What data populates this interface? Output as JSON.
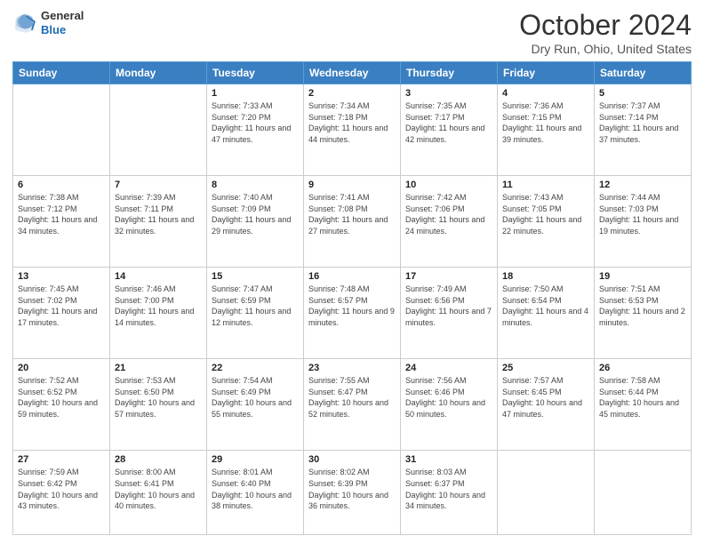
{
  "header": {
    "logo": {
      "general": "General",
      "blue": "Blue"
    },
    "title": "October 2024",
    "subtitle": "Dry Run, Ohio, United States"
  },
  "calendar": {
    "days_of_week": [
      "Sunday",
      "Monday",
      "Tuesday",
      "Wednesday",
      "Thursday",
      "Friday",
      "Saturday"
    ],
    "weeks": [
      [
        {
          "day": "",
          "sunrise": "",
          "sunset": "",
          "daylight": ""
        },
        {
          "day": "",
          "sunrise": "",
          "sunset": "",
          "daylight": ""
        },
        {
          "day": "1",
          "sunrise": "Sunrise: 7:33 AM",
          "sunset": "Sunset: 7:20 PM",
          "daylight": "Daylight: 11 hours and 47 minutes."
        },
        {
          "day": "2",
          "sunrise": "Sunrise: 7:34 AM",
          "sunset": "Sunset: 7:18 PM",
          "daylight": "Daylight: 11 hours and 44 minutes."
        },
        {
          "day": "3",
          "sunrise": "Sunrise: 7:35 AM",
          "sunset": "Sunset: 7:17 PM",
          "daylight": "Daylight: 11 hours and 42 minutes."
        },
        {
          "day": "4",
          "sunrise": "Sunrise: 7:36 AM",
          "sunset": "Sunset: 7:15 PM",
          "daylight": "Daylight: 11 hours and 39 minutes."
        },
        {
          "day": "5",
          "sunrise": "Sunrise: 7:37 AM",
          "sunset": "Sunset: 7:14 PM",
          "daylight": "Daylight: 11 hours and 37 minutes."
        }
      ],
      [
        {
          "day": "6",
          "sunrise": "Sunrise: 7:38 AM",
          "sunset": "Sunset: 7:12 PM",
          "daylight": "Daylight: 11 hours and 34 minutes."
        },
        {
          "day": "7",
          "sunrise": "Sunrise: 7:39 AM",
          "sunset": "Sunset: 7:11 PM",
          "daylight": "Daylight: 11 hours and 32 minutes."
        },
        {
          "day": "8",
          "sunrise": "Sunrise: 7:40 AM",
          "sunset": "Sunset: 7:09 PM",
          "daylight": "Daylight: 11 hours and 29 minutes."
        },
        {
          "day": "9",
          "sunrise": "Sunrise: 7:41 AM",
          "sunset": "Sunset: 7:08 PM",
          "daylight": "Daylight: 11 hours and 27 minutes."
        },
        {
          "day": "10",
          "sunrise": "Sunrise: 7:42 AM",
          "sunset": "Sunset: 7:06 PM",
          "daylight": "Daylight: 11 hours and 24 minutes."
        },
        {
          "day": "11",
          "sunrise": "Sunrise: 7:43 AM",
          "sunset": "Sunset: 7:05 PM",
          "daylight": "Daylight: 11 hours and 22 minutes."
        },
        {
          "day": "12",
          "sunrise": "Sunrise: 7:44 AM",
          "sunset": "Sunset: 7:03 PM",
          "daylight": "Daylight: 11 hours and 19 minutes."
        }
      ],
      [
        {
          "day": "13",
          "sunrise": "Sunrise: 7:45 AM",
          "sunset": "Sunset: 7:02 PM",
          "daylight": "Daylight: 11 hours and 17 minutes."
        },
        {
          "day": "14",
          "sunrise": "Sunrise: 7:46 AM",
          "sunset": "Sunset: 7:00 PM",
          "daylight": "Daylight: 11 hours and 14 minutes."
        },
        {
          "day": "15",
          "sunrise": "Sunrise: 7:47 AM",
          "sunset": "Sunset: 6:59 PM",
          "daylight": "Daylight: 11 hours and 12 minutes."
        },
        {
          "day": "16",
          "sunrise": "Sunrise: 7:48 AM",
          "sunset": "Sunset: 6:57 PM",
          "daylight": "Daylight: 11 hours and 9 minutes."
        },
        {
          "day": "17",
          "sunrise": "Sunrise: 7:49 AM",
          "sunset": "Sunset: 6:56 PM",
          "daylight": "Daylight: 11 hours and 7 minutes."
        },
        {
          "day": "18",
          "sunrise": "Sunrise: 7:50 AM",
          "sunset": "Sunset: 6:54 PM",
          "daylight": "Daylight: 11 hours and 4 minutes."
        },
        {
          "day": "19",
          "sunrise": "Sunrise: 7:51 AM",
          "sunset": "Sunset: 6:53 PM",
          "daylight": "Daylight: 11 hours and 2 minutes."
        }
      ],
      [
        {
          "day": "20",
          "sunrise": "Sunrise: 7:52 AM",
          "sunset": "Sunset: 6:52 PM",
          "daylight": "Daylight: 10 hours and 59 minutes."
        },
        {
          "day": "21",
          "sunrise": "Sunrise: 7:53 AM",
          "sunset": "Sunset: 6:50 PM",
          "daylight": "Daylight: 10 hours and 57 minutes."
        },
        {
          "day": "22",
          "sunrise": "Sunrise: 7:54 AM",
          "sunset": "Sunset: 6:49 PM",
          "daylight": "Daylight: 10 hours and 55 minutes."
        },
        {
          "day": "23",
          "sunrise": "Sunrise: 7:55 AM",
          "sunset": "Sunset: 6:47 PM",
          "daylight": "Daylight: 10 hours and 52 minutes."
        },
        {
          "day": "24",
          "sunrise": "Sunrise: 7:56 AM",
          "sunset": "Sunset: 6:46 PM",
          "daylight": "Daylight: 10 hours and 50 minutes."
        },
        {
          "day": "25",
          "sunrise": "Sunrise: 7:57 AM",
          "sunset": "Sunset: 6:45 PM",
          "daylight": "Daylight: 10 hours and 47 minutes."
        },
        {
          "day": "26",
          "sunrise": "Sunrise: 7:58 AM",
          "sunset": "Sunset: 6:44 PM",
          "daylight": "Daylight: 10 hours and 45 minutes."
        }
      ],
      [
        {
          "day": "27",
          "sunrise": "Sunrise: 7:59 AM",
          "sunset": "Sunset: 6:42 PM",
          "daylight": "Daylight: 10 hours and 43 minutes."
        },
        {
          "day": "28",
          "sunrise": "Sunrise: 8:00 AM",
          "sunset": "Sunset: 6:41 PM",
          "daylight": "Daylight: 10 hours and 40 minutes."
        },
        {
          "day": "29",
          "sunrise": "Sunrise: 8:01 AM",
          "sunset": "Sunset: 6:40 PM",
          "daylight": "Daylight: 10 hours and 38 minutes."
        },
        {
          "day": "30",
          "sunrise": "Sunrise: 8:02 AM",
          "sunset": "Sunset: 6:39 PM",
          "daylight": "Daylight: 10 hours and 36 minutes."
        },
        {
          "day": "31",
          "sunrise": "Sunrise: 8:03 AM",
          "sunset": "Sunset: 6:37 PM",
          "daylight": "Daylight: 10 hours and 34 minutes."
        },
        {
          "day": "",
          "sunrise": "",
          "sunset": "",
          "daylight": ""
        },
        {
          "day": "",
          "sunrise": "",
          "sunset": "",
          "daylight": ""
        }
      ]
    ]
  }
}
